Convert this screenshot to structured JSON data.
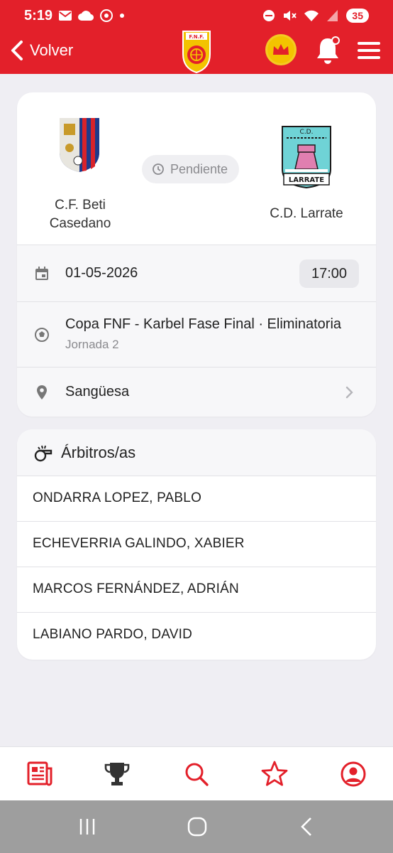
{
  "status_bar": {
    "time": "5:19",
    "battery": "35"
  },
  "header": {
    "back_label": "Volver",
    "crest_text": "F.N.F."
  },
  "match": {
    "home_team": "C.F. Beti Casedano",
    "away_team": "C.D. Larrate",
    "status": "Pendiente",
    "date": "01-05-2026",
    "time": "17:00",
    "competition": "Copa FNF - Karbel Fase Final · Eliminatoria",
    "round": "Jornada 2",
    "venue": "Sangüesa",
    "away_logo_top": "C.D.",
    "away_logo_bottom": "LARRATE"
  },
  "referees": {
    "title": "Árbitros/as",
    "list": [
      "ONDARRA LOPEZ, PABLO",
      "ECHEVERRIA GALINDO, XABIER",
      "MARCOS FERNÁNDEZ, ADRIÁN",
      "LABIANO PARDO, DAVID"
    ]
  },
  "bottom_nav": [
    "news-icon",
    "trophy-icon",
    "search-icon",
    "star-icon",
    "profile-icon"
  ],
  "colors": {
    "brand_red": "#e3202a",
    "gold": "#f3c300",
    "background": "#efeef3"
  }
}
